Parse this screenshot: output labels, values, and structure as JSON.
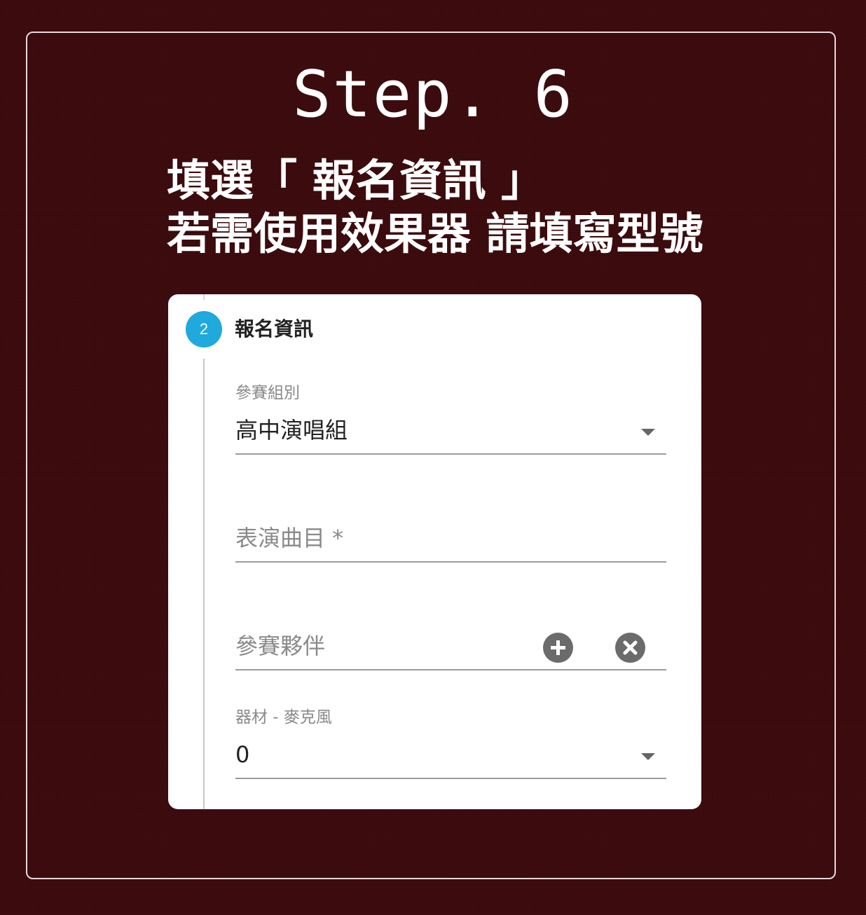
{
  "heading": {
    "step": "Step. 6",
    "line1": "填選「 報名資訊 」",
    "line2": "若需使用效果器 請填寫型號"
  },
  "form": {
    "step_number": "2",
    "step_title": "報名資訊",
    "group": {
      "label": "參賽組別",
      "value": "高中演唱組"
    },
    "song": {
      "placeholder": "表演曲目 *"
    },
    "partner": {
      "placeholder": "參賽夥伴",
      "add_icon": "plus-circle-icon",
      "remove_icon": "x-circle-icon"
    },
    "microphone": {
      "label": "器材 - 麥克風",
      "value": "0"
    }
  },
  "colors": {
    "background": "#3b0a0d",
    "accent": "#1fa9dd",
    "icon": "#6b6b6b"
  }
}
